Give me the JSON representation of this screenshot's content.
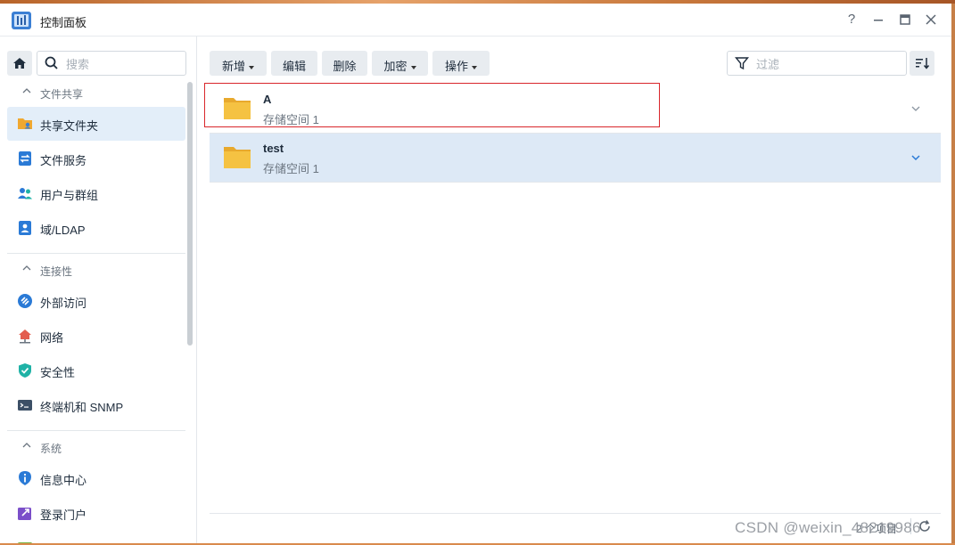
{
  "window": {
    "title": "控制面板"
  },
  "titlebar": {
    "help_label": "?",
    "minimize_label": "—",
    "maximize_label": "□",
    "close_label": "✕"
  },
  "search": {
    "placeholder": "搜索"
  },
  "sidebar": {
    "groups": [
      {
        "label": "文件共享",
        "items": [
          {
            "label": "共享文件夹",
            "icon": "shared-folder-icon",
            "active": true
          },
          {
            "label": "文件服务",
            "icon": "file-services-icon"
          },
          {
            "label": "用户与群组",
            "icon": "users-groups-icon"
          },
          {
            "label": "域/LDAP",
            "icon": "domain-ldap-icon"
          }
        ]
      },
      {
        "label": "连接性",
        "items": [
          {
            "label": "外部访问",
            "icon": "external-access-icon"
          },
          {
            "label": "网络",
            "icon": "network-icon"
          },
          {
            "label": "安全性",
            "icon": "security-shield-icon"
          },
          {
            "label": "终端机和 SNMP",
            "icon": "terminal-icon"
          }
        ]
      },
      {
        "label": "系统",
        "items": [
          {
            "label": "信息中心",
            "icon": "info-center-icon"
          },
          {
            "label": "登录门户",
            "icon": "login-portal-icon"
          }
        ]
      }
    ]
  },
  "toolbar": {
    "create": "新增",
    "edit": "编辑",
    "delete": "删除",
    "encrypt": "加密",
    "action": "操作"
  },
  "filter": {
    "placeholder": "过滤"
  },
  "folders": [
    {
      "name": "A",
      "location": "存储空间 1",
      "selected": false
    },
    {
      "name": "test",
      "location": "存储空间 1",
      "selected": true
    }
  ],
  "footer": {
    "count_text": "2 个项目"
  },
  "watermark": "CSDN @weixin_48219986",
  "colors": {
    "accent": "#2a7ad6",
    "selection": "#dde9f6",
    "folder": "#f5c242",
    "highlight_box": "#d9262b"
  }
}
